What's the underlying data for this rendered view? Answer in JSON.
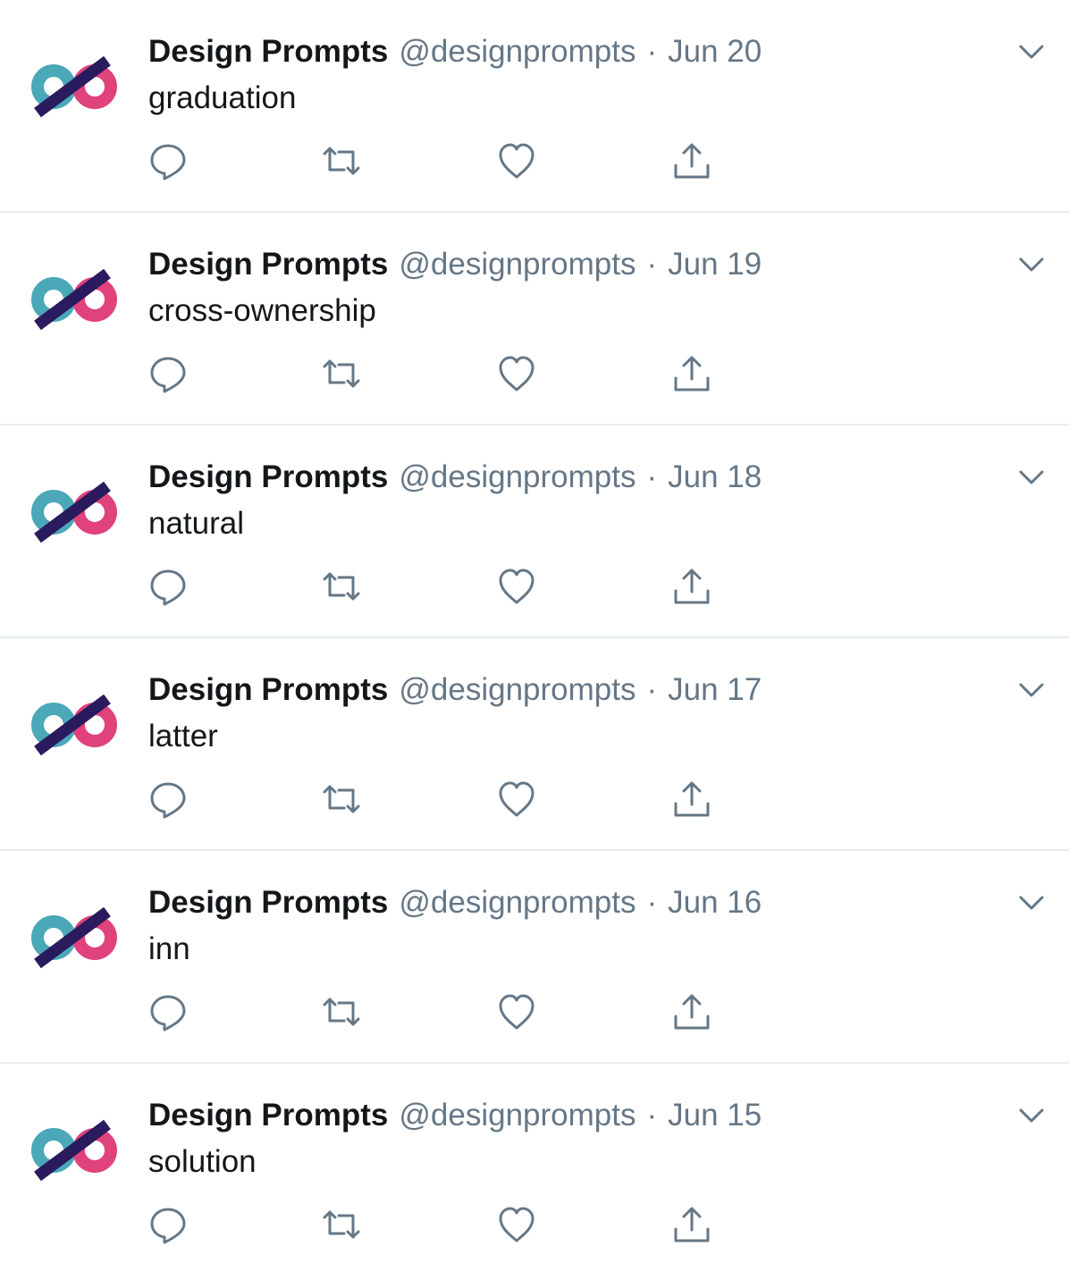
{
  "colors": {
    "name": "#14171a",
    "secondary": "#657786",
    "divider": "#e6ecf0",
    "logo_teal": "#4aa8b8",
    "logo_pink": "#e0427c",
    "logo_navy": "#2a1a5e"
  },
  "icons": {
    "avatar": "design-prompts-logo",
    "reply": "reply-icon",
    "retweet": "retweet-icon",
    "like": "like-icon",
    "share": "share-icon",
    "more": "chevron-down-icon"
  },
  "tweets": [
    {
      "name": "Design Prompts",
      "handle": "@designprompts",
      "separator": "·",
      "date": "Jun 20",
      "text": "graduation"
    },
    {
      "name": "Design Prompts",
      "handle": "@designprompts",
      "separator": "·",
      "date": "Jun 19",
      "text": "cross-ownership"
    },
    {
      "name": "Design Prompts",
      "handle": "@designprompts",
      "separator": "·",
      "date": "Jun 18",
      "text": "natural"
    },
    {
      "name": "Design Prompts",
      "handle": "@designprompts",
      "separator": "·",
      "date": "Jun 17",
      "text": "latter"
    },
    {
      "name": "Design Prompts",
      "handle": "@designprompts",
      "separator": "·",
      "date": "Jun 16",
      "text": "inn"
    },
    {
      "name": "Design Prompts",
      "handle": "@designprompts",
      "separator": "·",
      "date": "Jun 15",
      "text": "solution"
    }
  ]
}
